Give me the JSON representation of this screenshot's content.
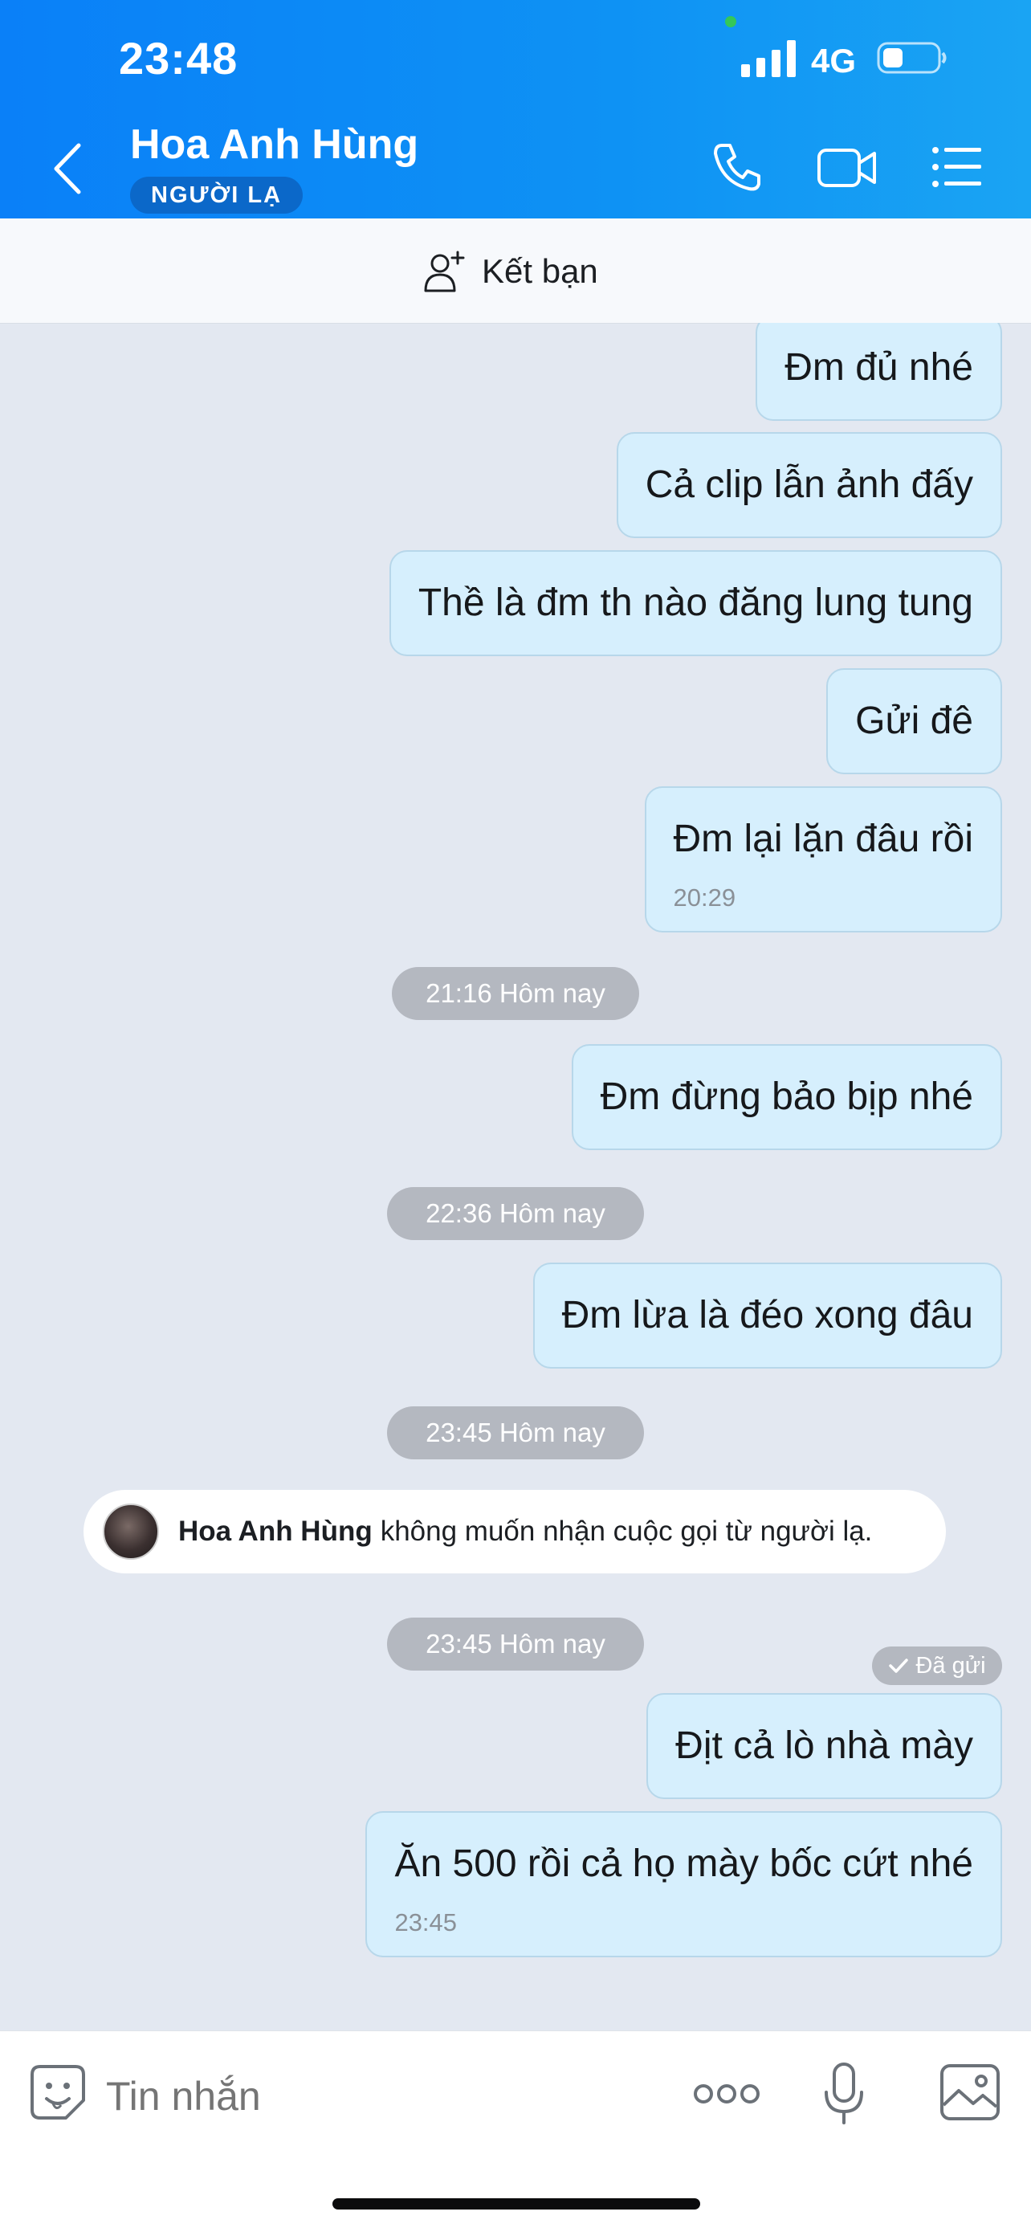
{
  "status_bar": {
    "time": "23:48",
    "network": "4G"
  },
  "header": {
    "contact_name": "Hoa Anh Hùng",
    "badge": "NGƯỜI LẠ"
  },
  "add_friend": {
    "label": "Kết bạn"
  },
  "messages": [
    {
      "text": "Đm đủ nhé"
    },
    {
      "text": "Cả clip lẫn ảnh đấy"
    },
    {
      "text": "Thề là đm th nào đăng lung tung"
    },
    {
      "text": "Gửi đê"
    },
    {
      "text": "Đm lại lặn đâu rồi",
      "time": "20:29"
    },
    {
      "text": "Đm đừng bảo bịp nhé"
    },
    {
      "text": "Đm lừa là đéo xong đâu"
    },
    {
      "text": "Địt cả lò nhà mày"
    },
    {
      "text": "Ăn 500 rồi cả họ mày bốc cứt nhé",
      "time": "23:45"
    }
  ],
  "timestamps": [
    "21:16 Hôm nay",
    "22:36 Hôm nay",
    "23:45 Hôm nay",
    "23:45 Hôm nay"
  ],
  "notice": {
    "name": "Hoa Anh Hùng",
    "text": "không muốn nhận cuộc gọi từ người lạ."
  },
  "sent_status": "Đã gửi",
  "input": {
    "placeholder": "Tin nhắn"
  },
  "icons": {
    "back": "chevron-left-icon",
    "call": "phone-icon",
    "video": "video-camera-icon",
    "menu": "list-menu-icon",
    "add_friend": "add-user-icon",
    "emoji": "emoji-sticker-icon",
    "more": "more-dots-icon",
    "mic": "microphone-icon",
    "image": "image-gallery-icon"
  },
  "colors": {
    "header": "#0a80f8",
    "bubble": "#d6effd",
    "chat_bg": "#e3e8f1",
    "badge": "#0b68c9"
  }
}
